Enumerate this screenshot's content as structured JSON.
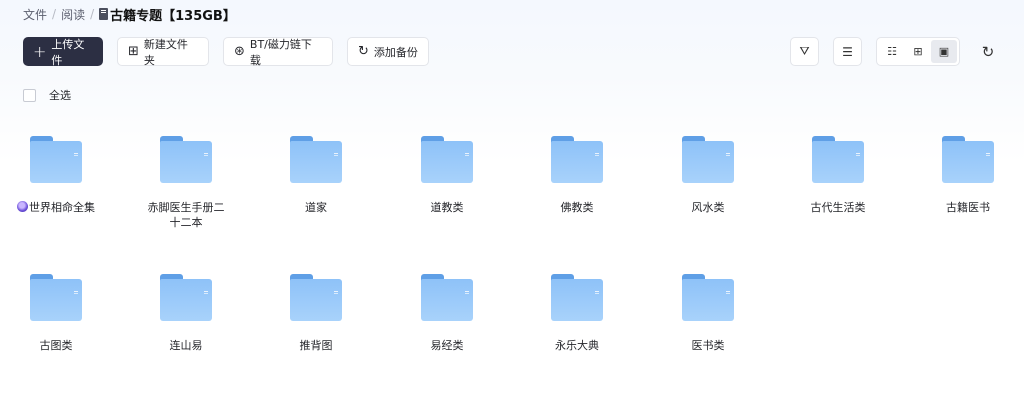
{
  "breadcrumb": {
    "items": [
      "文件",
      "阅读"
    ],
    "separator": "/",
    "current": "古籍专题【135GB】"
  },
  "toolbar": {
    "upload": "上传文件",
    "new_folder": "新建文件夹",
    "bt_download": "BT/磁力链下载",
    "add_backup": "添加备份"
  },
  "select_all": "全选",
  "folders": [
    "世界相命全集",
    "赤脚医生手册二十二本",
    "道家",
    "道教类",
    "佛教类",
    "风水类",
    "古代生活类",
    "古籍医书",
    "古图类",
    "连山易",
    "推背图",
    "易经类",
    "永乐大典",
    "医书类"
  ],
  "colors": {
    "primary_button": "#2c2f43",
    "folder_blue": "#8ec2f8"
  }
}
